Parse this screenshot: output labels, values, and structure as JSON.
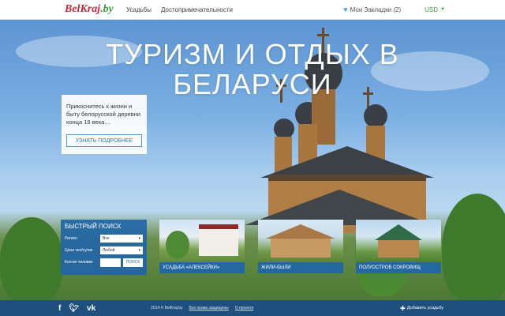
{
  "header": {
    "logo_main": "BelKraj",
    "logo_suffix": ".by",
    "nav": [
      "Усадьбы",
      "Достопримечательности"
    ],
    "bookmarks": "Мои Закладки (2)",
    "currency": "USD"
  },
  "hero": {
    "headline_line1": "ТУРИЗМ И ОТДЫХ В",
    "headline_line2": "БЕЛАРУСИ"
  },
  "promo": {
    "text": "Прикоснитесь к жизни и быту белорусской деревни конца 19 века…",
    "button": "УЗНАТЬ ПОДРОБНЕЕ"
  },
  "quick_search": {
    "title": "БЫСТРЫЙ ПОИСК",
    "region_label": "Регион",
    "region_value": "Все",
    "price_label": "Цена чел/сутки",
    "price_value": "Любой",
    "people_label": "Кол-во человек",
    "search_button": "ПОИСК"
  },
  "cards": [
    {
      "title": "УСАДЬБА «АЛЕКСЕЙКИ»"
    },
    {
      "title": "ЖИЛИ-БЫЛИ"
    },
    {
      "title": "ПОЛУОСТРОВ СОКРОВИЩ"
    }
  ],
  "footer": {
    "copyright": "2014 © BelKraj.by",
    "rights": "Все права защищены",
    "about": "О проекте",
    "add": "Добавить усадьбу"
  },
  "colors": {
    "accent_blue": "#2266a6",
    "footer_blue": "#1f4f7d",
    "logo_red": "#c8273a",
    "logo_green": "#3d9c3a"
  }
}
